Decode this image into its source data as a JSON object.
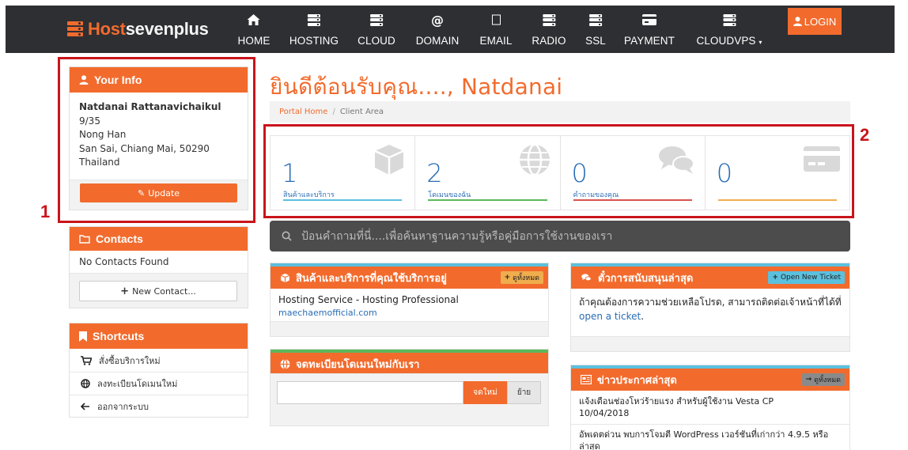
{
  "brand": {
    "part1": "Host",
    "part2": "sevenplus"
  },
  "nav": {
    "items": [
      {
        "label": "HOME",
        "icon": "home-icon"
      },
      {
        "label": "HOSTING",
        "icon": "server-icon"
      },
      {
        "label": "CLOUD",
        "icon": "server-icon"
      },
      {
        "label": "DOMAIN",
        "icon": "at-icon"
      },
      {
        "label": "EMAIL",
        "icon": "envelope-icon"
      },
      {
        "label": "RADIO",
        "icon": "server-icon"
      },
      {
        "label": "SSL",
        "icon": "server-icon"
      },
      {
        "label": "PAYMENT",
        "icon": "credit-card-icon"
      },
      {
        "label": "CLOUDVPS",
        "icon": "server-icon"
      }
    ],
    "login_label": "LOGIN"
  },
  "sidebar": {
    "info": {
      "title": "Your Info",
      "name": "Natdanai Rattanavichaikul",
      "address1": "9/35",
      "address2": "Nong Han",
      "address3": "San Sai, Chiang Mai, 50290",
      "country": "Thailand",
      "update_label": "Update"
    },
    "contacts": {
      "title": "Contacts",
      "empty_text": "No Contacts Found",
      "new_label": "New Contact..."
    },
    "shortcuts": {
      "title": "Shortcuts",
      "items": [
        {
          "label": "สั่งซื้อบริการใหม่",
          "icon": "cart-icon"
        },
        {
          "label": "ลงทะเบียนโดเมนใหม่",
          "icon": "globe-icon"
        },
        {
          "label": "ออกจากระบบ",
          "icon": "arrow-left-icon"
        }
      ]
    }
  },
  "main": {
    "welcome": "ยินดีต้อนรับคุณ...., Natdanai",
    "breadcrumb": {
      "home": "Portal Home",
      "separator": "/",
      "current": "Client Area"
    },
    "tiles": [
      {
        "value": "1",
        "caption": "สินค้าและบริการ",
        "color": "#5bc0de",
        "icon": "cube-icon"
      },
      {
        "value": "2",
        "caption": "โดเมนของฉัน",
        "color": "#5cb85c",
        "icon": "globe-icon"
      },
      {
        "value": "0",
        "caption": "คำถามของคุณ",
        "color": "#d9534f",
        "icon": "comments-icon"
      },
      {
        "value": "0",
        "caption": "",
        "color": "#f0ad4e",
        "icon": "credit-card-icon"
      }
    ],
    "search_placeholder": "ป้อนคำถามที่นี่....เพื่อค้นหาฐานความรู้หรือคู่มือการใช้งานของเรา",
    "services": {
      "title": "สินค้าและบริการที่คุณใช้บริการอยู่",
      "view_all": "ดูทั้งหมด",
      "item_name": "Hosting Service - Hosting Professional",
      "item_domain": "maechaemofficial.com"
    },
    "domain_register": {
      "title": "จดทะเบียนโดเมนใหม่กับเรา",
      "register_label": "จดใหม่",
      "transfer_label": "ย้าย"
    },
    "tickets": {
      "title": "ตั๋วการสนับสนุนล่าสุด",
      "open_label": "Open New Ticket",
      "body": "ถ้าคุณต้องการความช่วยเหลือโปรด, สามารถติดต่อเจ้าหน้าที่ได้ที่",
      "link": "open a ticket",
      "period": "."
    },
    "news": {
      "title": "ข่าวประกาศล่าสุด",
      "view_all": "ดูทั้งหมด",
      "item1_title": "แจ้งเตือนช่องโหว่ร้ายแรง สำหรับผู้ใช้งาน Vesta CP",
      "item1_date": "10/04/2018",
      "item2_title": "อัพเดตด่วน พบการโจมตี WordPress เวอร์ชันที่เก่ากว่า 4.9.5 หรือ",
      "item2_more": "ล่าสุด"
    }
  },
  "annotations": {
    "box1": "1",
    "box2": "2"
  },
  "colors": {
    "accent": "#f26b2d",
    "navbar": "#2e2f33",
    "annotation": "#c9141b",
    "link": "#2a6db5"
  }
}
